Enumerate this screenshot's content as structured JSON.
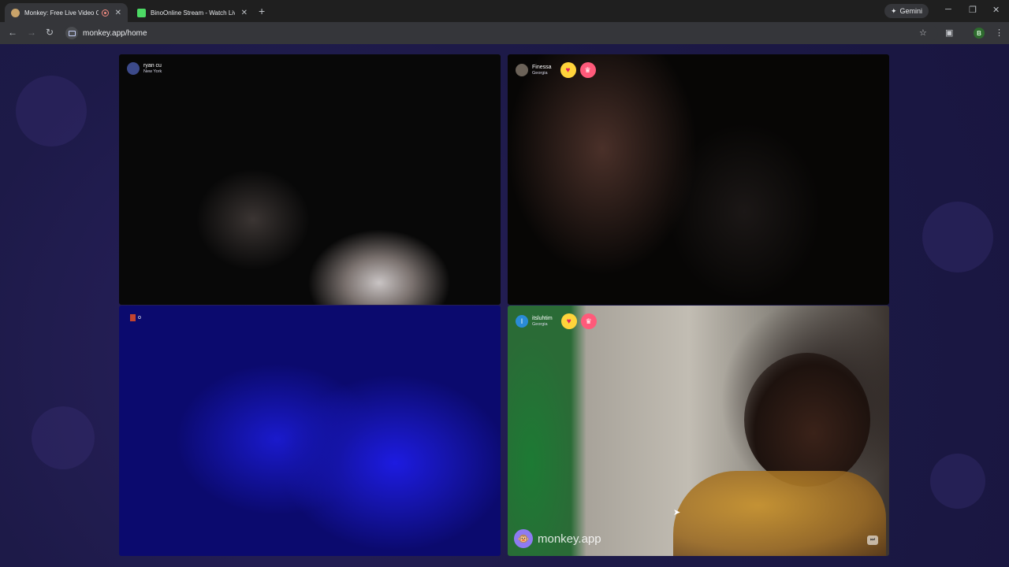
{
  "browser": {
    "tabs": [
      {
        "title": "Monkey: Free Live Video Ch",
        "active": true,
        "favicon_color": "#c9a36a"
      },
      {
        "title": "BinoOnline Stream - Watch Live",
        "active": false,
        "favicon_color": "#4cd964"
      }
    ],
    "new_tab_symbol": "+",
    "gemini_label": "Gemini",
    "url": "monkey.app/home",
    "profile_initial": "B"
  },
  "video_tiles": [
    {
      "username": "ryan cu",
      "location": "New York"
    },
    {
      "username": "Finessa",
      "location": "Georgia"
    },
    {
      "username": "",
      "location": "",
      "flag_text": "o"
    },
    {
      "username": "itsluhtim",
      "location": "Georgia",
      "avatar_letter": "I"
    }
  ],
  "watermark": {
    "text": "monkey.app"
  },
  "colors": {
    "page_background": "#1d1a48",
    "heart_badge": "#ffd43b",
    "crown_badge": "#ff5a7a",
    "watermark_logo": "#8e7bf2"
  }
}
